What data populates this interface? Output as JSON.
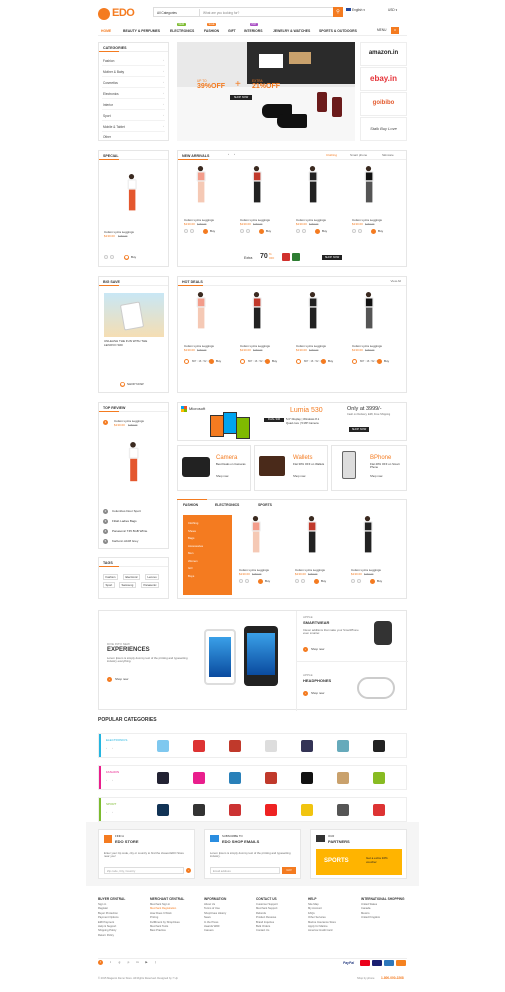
{
  "brand": {
    "name": "EDO"
  },
  "search": {
    "category": "All Categories",
    "placeholder": "What are you looking for?"
  },
  "header": {
    "language": "English",
    "currency": "USD"
  },
  "nav": {
    "items": [
      "HOME",
      "BEAUTY & PERFUMES",
      "ELECTRONICS",
      "FASHION",
      "GIFT",
      "INTERIORS",
      "JEWELRY & WATCHES",
      "SPORTS & OUTDOORS"
    ],
    "tags": [
      "NEW",
      "SALE",
      "HOT"
    ],
    "cart_label": "MENU",
    "cart_count": "0"
  },
  "categories": {
    "title": "CATEGORIES",
    "items": [
      "Fashion",
      "Mother & Baby",
      "Cosmetics",
      "Electronics",
      "Interior",
      "Sport",
      "Mobile & Tablet",
      "Other"
    ]
  },
  "hero": {
    "left_line1": "UP TO",
    "left_big": "39%OFF",
    "plus": "+",
    "right_line1": "EXTRA",
    "right_big": "21%OFF",
    "cta": "SHOP NOW"
  },
  "brands": {
    "amazon": "amazon.in",
    "ebay": "ebay.in",
    "goibibo": "goibibo",
    "stalk": "Stalk Buy Love"
  },
  "special": {
    "title": "SPECIAL",
    "name": "Cotton Lycra Leggings",
    "price": "$130.00",
    "old": "$160.00",
    "buy": "Buy"
  },
  "new_arrivals": {
    "title": "NEW ARRIVALS",
    "tabs": [
      "Clothing",
      "Smart phone",
      "Skincare"
    ]
  },
  "product": {
    "name": "Cotton Lycra Leggings",
    "price": "$130.00",
    "old": "$160.00",
    "buy": "Buy"
  },
  "extra_banner": {
    "extra": "Extra",
    "pct": "70",
    "pct_suffix": "%",
    "off": "OFF",
    "shop": "SHOP NOW"
  },
  "big_save": {
    "title": "BIG SAVE",
    "desc": "UNLEASH THE FUN WITH THE LENOVO S60",
    "cta": "SHOP NOW"
  },
  "hot_deals": {
    "title": "HOT DEALS",
    "view_all": "View All",
    "timer": "807 : 16 : 52 : 8"
  },
  "top_review": {
    "title": "TOP REVIEW",
    "items": [
      "Columbus Door Sport",
      "Fitlab Ladies Bags",
      "Panasonic T45 8GB White",
      "Karbonn A108 Grey"
    ]
  },
  "microsoft": {
    "brand": "Microsoft",
    "model": "Lumia 530",
    "only_at": "Only at 3999/-",
    "dual_sim": "DUAL SIM",
    "specs1": "5.0\" Display | Windows 8.1",
    "specs2": "Quad core | 5 MP Camera",
    "cta": "SHOP NOW",
    "cod": "Cash on Delivery, EMI, Free Shipping"
  },
  "promos": [
    {
      "title": "Camera",
      "desc": "Best Deals on Cameras",
      "cta": "Shop now"
    },
    {
      "title": "Wallets",
      "desc": "Flat 30% OFF on Wallets",
      "cta": "Shop now"
    },
    {
      "title": "BPhone",
      "desc": "Flat 40% OFF on Smart Phone",
      "cta": "Shop now"
    }
  ],
  "fashion_tabs": [
    "FASHION",
    "ELECTRONICS",
    "SPORTS"
  ],
  "fashion_menu": [
    "Clothing",
    "Shoes",
    "Bags",
    "Accessories",
    "Men",
    "Women",
    "Girl",
    "Boys"
  ],
  "tags": {
    "title": "TAGS",
    "items": [
      "Fashion",
      "Electronic",
      "Lenovo",
      "Sport",
      "Samsung",
      "Panasonic"
    ]
  },
  "experiences": {
    "small": "DIVE INTO NEW",
    "big": "EXPERIENCES",
    "desc": "Lorem Ipsum is simply dummy text of the printing and typesetting industry everything.",
    "cta": "Shop now"
  },
  "smartwear": {
    "label": "APPLE",
    "title": "SMARTWEAR",
    "desc": "Clever additions that make your SmartPhone even smarter.",
    "cta": "Shop now"
  },
  "headphones": {
    "label": "APPLE",
    "title": "HEADPHONES",
    "cta": "Shop now"
  },
  "popular": {
    "title": "POPULAR CATEGORIES",
    "rows": [
      "ELECTRONICS",
      "FASHION",
      "SPORT"
    ],
    "colors": [
      "#25b5e0",
      "#e91e8c",
      "#7cbb2f"
    ]
  },
  "find_store": {
    "small": "FIND A",
    "title": "EDO STORE",
    "desc": "Enter your zip code, city or country to find the closest EDO Store near you!",
    "placeholder": "Zip code, City, Country"
  },
  "subscribe": {
    "small": "SUBSCRIBE TO",
    "title": "EDO SHOP EMAILS",
    "desc": "Lorem Ipsum is simply dummy text of the printing and typesetting industry.",
    "placeholder": "Email address",
    "cta": "GO!"
  },
  "partners": {
    "small": "OUR",
    "title": "PARTNERS",
    "sports": "SPORTS",
    "offer": "Get a extra 10% voucher"
  },
  "footer": {
    "cols": [
      {
        "h": "BUYER CENTRAL",
        "l": [
          "Sign in",
          "Register",
          "Buyer Protection",
          "Payment Options",
          "EMI Payment",
          "Help & Support",
          "Shipping Policy",
          "Return Policy"
        ]
      },
      {
        "h": "MERCHANT CENTRAL",
        "l": [
          "Merchant Sign in",
          "Merchant Registration",
          "How Does It Work",
          "Pricing",
          "Fulfillment by ShopClues",
          "Merchant Tools",
          "Best Practice"
        ]
      },
      {
        "h": "INFORMATION",
        "l": [
          "About Us",
          "Terms of Use",
          "ShopClues History",
          "News",
          "In the Press",
          "Awards WDF",
          "Careers"
        ]
      },
      {
        "h": "CONTACT US",
        "l": [
          "Customer Support",
          "Merchant Support",
          "Refunds",
          "Product Reviews",
          "Brand Inquiries",
          "Bulk Orders",
          "Contact Us"
        ]
      },
      {
        "h": "HELP",
        "l": [
          "Site Map",
          "My Account",
          "FAQs",
          "Other Services",
          "Marine Insurance Store",
          "Apply for Marine",
          "America Credit Card"
        ]
      },
      {
        "h": "INTERNATIONAL SHOPPING",
        "l": [
          "United States",
          "Canada",
          "Mexico",
          "United Kingdom"
        ]
      }
    ],
    "copyright": "© 2015 Magento Demo Store. All Rights Reserved. Designed by 7 Up",
    "support": "Shop by phone",
    "phone": "1-800-000-2268",
    "paypal": "PayPal"
  }
}
